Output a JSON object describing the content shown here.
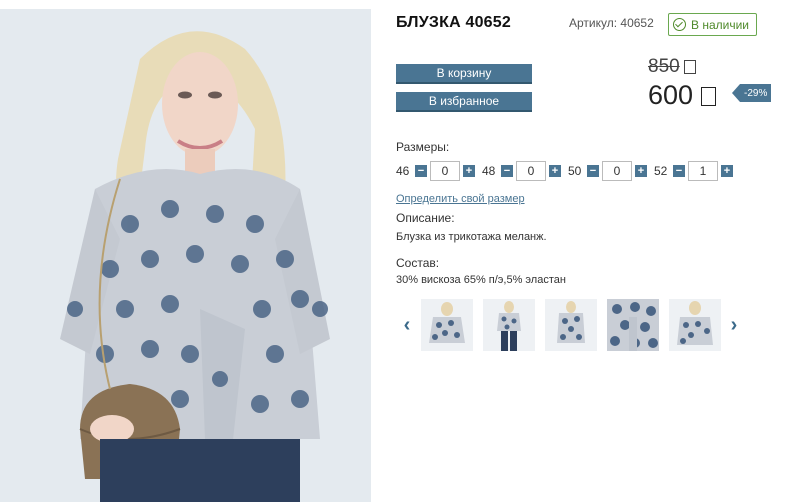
{
  "product": {
    "title": "БЛУЗКА 40652",
    "sku_label": "Артикул: 40652",
    "stock_label": "В наличии"
  },
  "buttons": {
    "cart": "В корзину",
    "favorite": "В избранное"
  },
  "price": {
    "old": "850",
    "new": "600",
    "discount": "-29%"
  },
  "sizes": {
    "label": "Размеры:",
    "items": [
      {
        "size": "46",
        "qty": "0"
      },
      {
        "size": "48",
        "qty": "0"
      },
      {
        "size": "50",
        "qty": "0"
      },
      {
        "size": "52",
        "qty": "1"
      }
    ],
    "minus": "−",
    "plus": "+",
    "size_link": "Определить свой размер"
  },
  "description": {
    "label": "Описание:",
    "text": "Блузка из трикотажа меланж."
  },
  "composition": {
    "label": "Состав:",
    "text": "30% вискоза 65% п/э,5% эластан"
  },
  "gallery": {
    "prev_icon": "chevron-left-icon",
    "next_icon": "chevron-right-icon",
    "prev_glyph": "‹",
    "next_glyph": "›"
  },
  "colors": {
    "accent": "#4a7593",
    "stock_green": "#4f8a2b",
    "fabric": "#c9ced6",
    "dots": "#4c6687"
  }
}
